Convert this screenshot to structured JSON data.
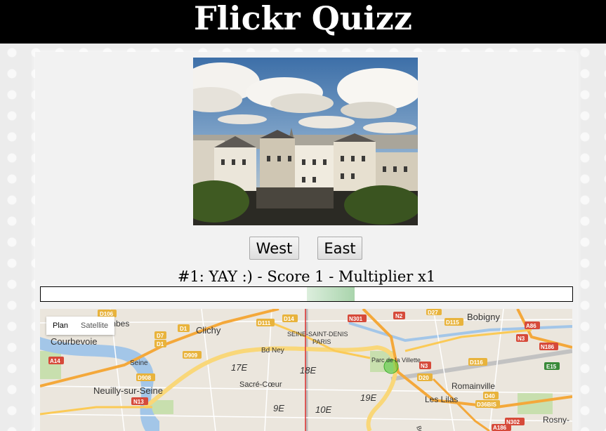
{
  "header": {
    "title": "Flickr Quizz"
  },
  "photo": {
    "description_icon": "photo-image"
  },
  "buttons": {
    "west": "West",
    "east": "East"
  },
  "status": {
    "text": "#1: YAY :) - Score 1 - Multiplier x1"
  },
  "progress": {
    "fraction_start": 0.5,
    "fraction_width": 0.09
  },
  "map": {
    "type_controls": {
      "plan": "Plan",
      "satellite": "Satellite"
    },
    "places": {
      "clichy": "Clichy",
      "courbevoie": "Courbevoie",
      "neuilly": "Neuilly-sur-Seine",
      "bobigny": "Bobigny",
      "romainville": "Romainville",
      "les_lilas": "Les Lilas",
      "rosny": "Rosny-",
      "seine_saint_denis": "SEINE-SAINT-DENIS",
      "paris": "PARIS",
      "sacre_coeur": "Sacré-Cœur",
      "parc_villette": "Parc de la Villette",
      "bd_ney": "Bd Ney",
      "seine": "Seine",
      "mbes": "mbes",
      "arr_17": "17E",
      "arr_18": "18E",
      "arr_19": "19E",
      "arr_9": "9E",
      "arr_10": "10E"
    },
    "roads": [
      "D106",
      "D7",
      "D1",
      "D1",
      "D111",
      "D14",
      "N301",
      "N2",
      "D27",
      "D115",
      "A86",
      "N3",
      "N186",
      "A14",
      "D909",
      "D908",
      "N13",
      "N3",
      "D116",
      "E15",
      "D20",
      "D40",
      "D36BIS",
      "N302",
      "A186",
      "Bd M"
    ]
  }
}
